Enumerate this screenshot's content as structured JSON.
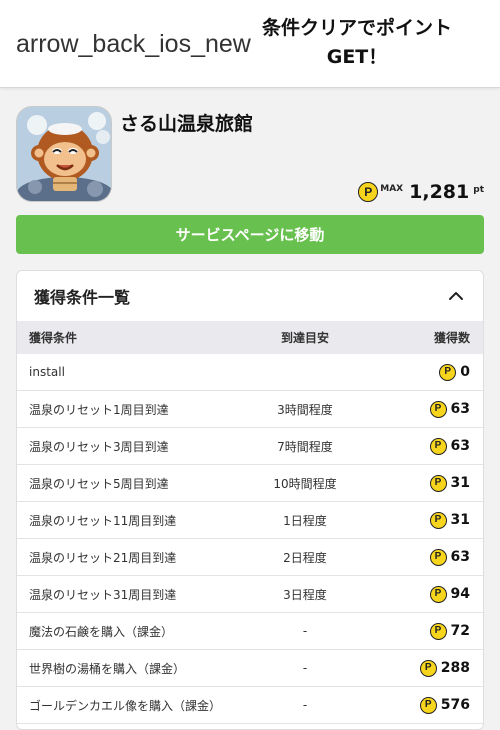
{
  "header": {
    "back_icon_text": "arrow_back_ios_new",
    "title": "条件クリアでポイントGET！"
  },
  "app": {
    "name": "さる山温泉旅館",
    "max_label": "MAX",
    "max_points": "1,281",
    "points_unit": "pt"
  },
  "service_button": {
    "label": "サービスページに移動"
  },
  "conditions": {
    "title": "獲得条件一覧",
    "columns": [
      "獲得条件",
      "到達目安",
      "獲得数"
    ],
    "rows": [
      {
        "condition": "install",
        "goal": "",
        "points": "0"
      },
      {
        "condition": "温泉のリセット1周目到達",
        "goal": "3時間程度",
        "points": "63"
      },
      {
        "condition": "温泉のリセット3周目到達",
        "goal": "7時間程度",
        "points": "63"
      },
      {
        "condition": "温泉のリセット5周目到達",
        "goal": "10時間程度",
        "points": "31"
      },
      {
        "condition": "温泉のリセット11周目到達",
        "goal": "1日程度",
        "points": "31"
      },
      {
        "condition": "温泉のリセット21周目到達",
        "goal": "2日程度",
        "points": "63"
      },
      {
        "condition": "温泉のリセット31周目到達",
        "goal": "3日程度",
        "points": "94"
      },
      {
        "condition": "魔法の石鹸を購入（課金）",
        "goal": "-",
        "points": "72"
      },
      {
        "condition": "世界樹の湯桶を購入（課金）",
        "goal": "-",
        "points": "288"
      },
      {
        "condition": "ゴールデンカエル像を購入（課金）",
        "goal": "-",
        "points": "576"
      }
    ]
  },
  "coin_symbol": "P",
  "colors": {
    "accent_green": "#68c04f",
    "coin_yellow": "#f7d51d",
    "header_row_bg": "#e9e9ee"
  },
  "icons": {
    "back": "arrow-back-icon",
    "collapse": "chevron-up-icon",
    "coin": "point-coin-icon"
  }
}
